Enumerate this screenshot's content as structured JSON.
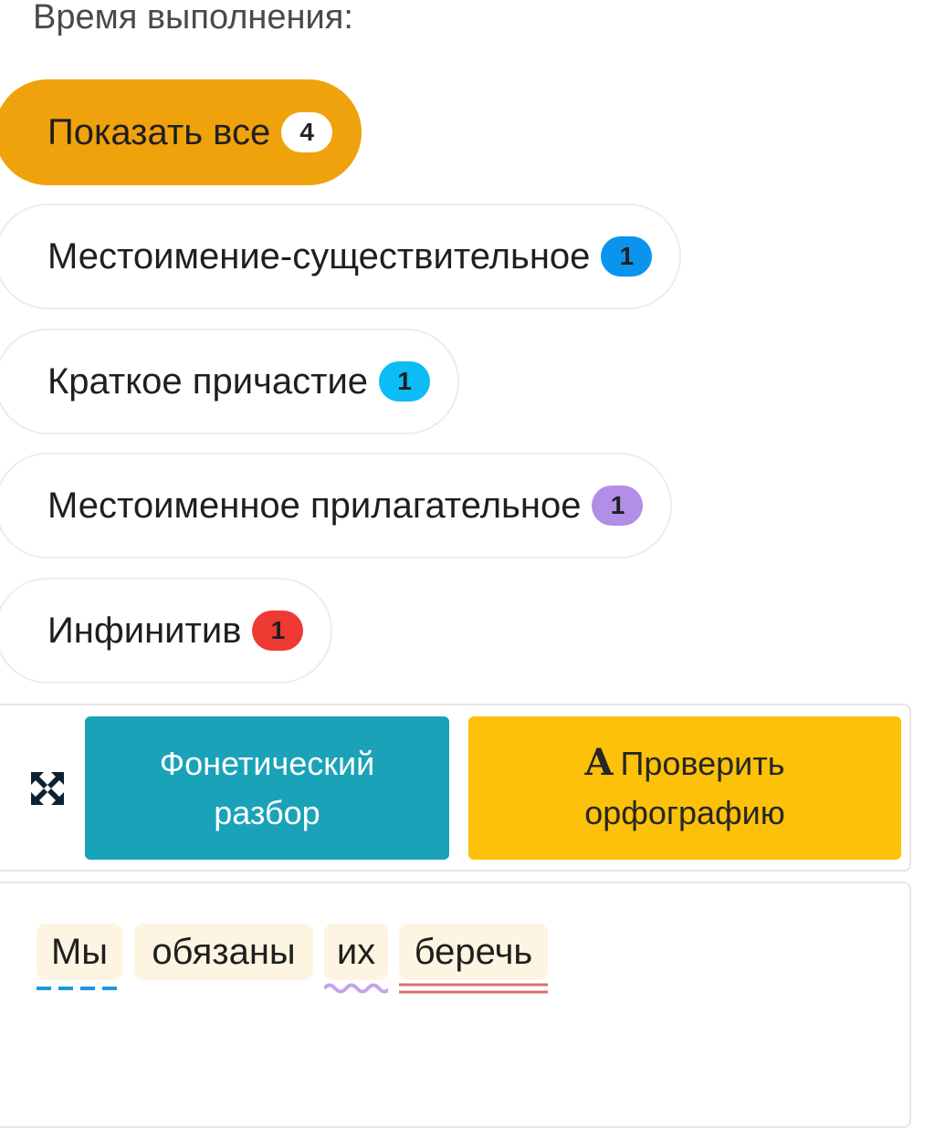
{
  "header": {
    "time_label": "Время выполнения:"
  },
  "filters": [
    {
      "label": "Показать все",
      "count": "4",
      "badge_color": "#ffffff",
      "badge_text_color": "#212529",
      "active": true
    },
    {
      "label": "Местоимение-существительное",
      "count": "1",
      "badge_color": "#0a94ee",
      "badge_text_color": "#1f1f1f",
      "active": false
    },
    {
      "label": "Краткое причастие",
      "count": "1",
      "badge_color": "#0cbcf4",
      "badge_text_color": "#1f1f1f",
      "active": false
    },
    {
      "label": "Местоименное прилагательное",
      "count": "1",
      "badge_color": "#b28ee6",
      "badge_text_color": "#1f1f1f",
      "active": false
    },
    {
      "label": "Инфинитив",
      "count": "1",
      "badge_color": "#ee3a32",
      "badge_text_color": "#1f1f1f",
      "active": false
    }
  ],
  "tools": {
    "expand_icon": "expand-arrows-icon",
    "phonetic_label_line1": "Фонетический",
    "phonetic_label_line2": "разбор",
    "spell_icon_glyph": "A",
    "spell_label_line1": "Проверить",
    "spell_label_line2": "орфографию",
    "phonetic_color": "#1aa2b8",
    "spell_color": "#fcc108"
  },
  "sentence": {
    "words": [
      {
        "text": "Мы",
        "underline": "dashed",
        "underline_color": "#1b98e0"
      },
      {
        "text": "обязаны",
        "underline": "none",
        "underline_color": ""
      },
      {
        "text": "их",
        "underline": "wavy",
        "underline_color": "#c2a3ef"
      },
      {
        "text": "беречь",
        "underline": "double",
        "underline_color": "#d9706a"
      }
    ]
  },
  "colors": {
    "active_filter": "#f0a20c",
    "word_bg": "#fdf5e1"
  }
}
